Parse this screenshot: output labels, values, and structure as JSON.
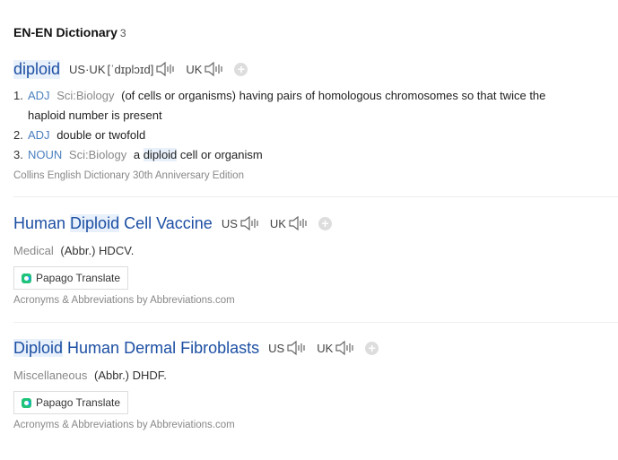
{
  "header": {
    "title": "EN-EN Dictionary",
    "count": "3"
  },
  "entry1": {
    "word": "diploid",
    "us_label": "US·UK",
    "pron": "[ˈdɪplɔɪd]",
    "uk_label": "UK",
    "definitions": [
      {
        "num": "1.",
        "pos": "ADJ",
        "field": "Sci:Biology",
        "text_line1": "(of cells or organisms) having pairs of homologous chromosomes so that twice the",
        "text_line2": "haploid number is present"
      },
      {
        "num": "2.",
        "pos": "ADJ",
        "text": "double or twofold"
      },
      {
        "num": "3.",
        "pos": "NOUN",
        "field": "Sci:Biology",
        "pre": "a",
        "hl": "diploid",
        "post": "cell or organism"
      }
    ],
    "source": "Collins English Dictionary 30th Anniversary Edition"
  },
  "entry2": {
    "w1": "Human",
    "w2": "Diploid",
    "w3": "Cell Vaccine",
    "us_label": "US",
    "uk_label": "UK",
    "category": "Medical",
    "sense": "(Abbr.) HDCV.",
    "translate": "Papago Translate",
    "source": "Acronyms & Abbreviations by Abbreviations.com"
  },
  "entry3": {
    "w1": "Diploid",
    "w2": "Human Dermal Fibroblasts",
    "us_label": "US",
    "uk_label": "UK",
    "category": "Miscellaneous",
    "sense": "(Abbr.) DHDF.",
    "translate": "Papago Translate",
    "source": "Acronyms & Abbreviations by Abbreviations.com"
  }
}
